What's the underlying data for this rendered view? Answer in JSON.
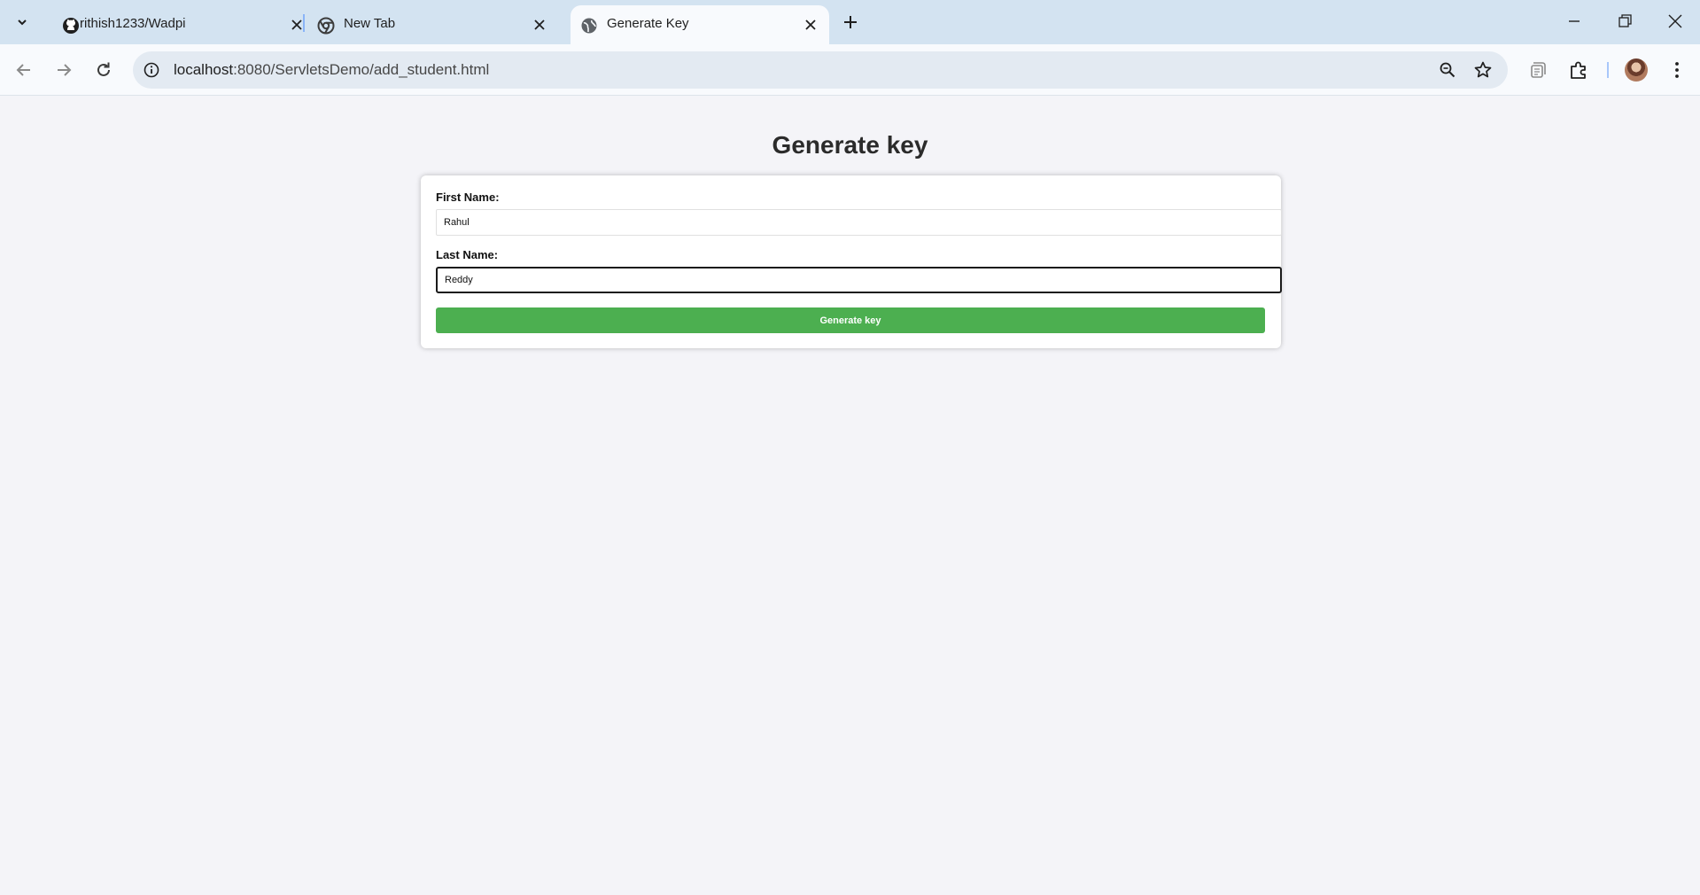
{
  "browser": {
    "tabs": [
      {
        "title": "rithish1233/Wadpi",
        "icon": "github-icon",
        "active": false
      },
      {
        "title": "New Tab",
        "icon": "chrome-icon",
        "active": false
      },
      {
        "title": "Generate Key",
        "icon": "globe-icon",
        "active": true
      }
    ],
    "address": {
      "host": "localhost",
      "path": ":8080/ServletsDemo/add_student.html"
    },
    "colors": {
      "tabstrip": "#d3e3f1",
      "toolbar": "#f8fafd",
      "omnibox": "#e3eaf2"
    }
  },
  "page": {
    "title": "Generate key",
    "form": {
      "first_name_label": "First Name:",
      "first_name_value": "Rahul",
      "last_name_label": "Last Name:",
      "last_name_value": "Reddy",
      "submit_label": "Generate key"
    },
    "colors": {
      "background": "#f4f4f8",
      "button": "#4caf50",
      "button_text": "#ffffff"
    }
  }
}
